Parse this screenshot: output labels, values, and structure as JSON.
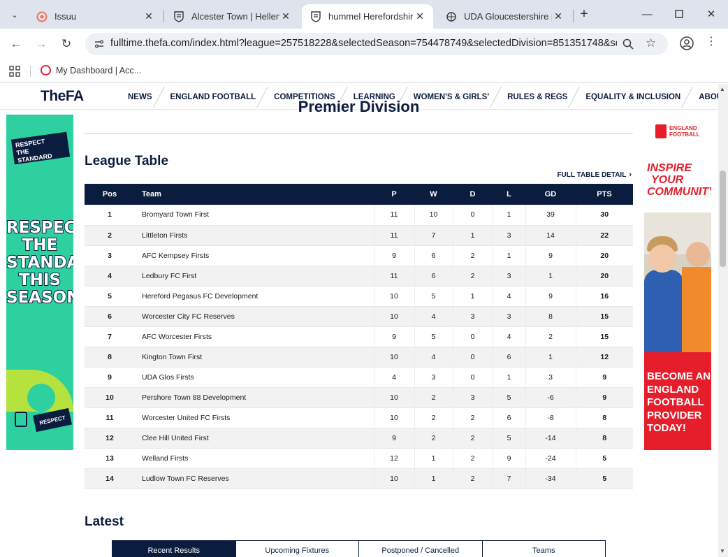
{
  "browser": {
    "tabs": [
      {
        "title": "Issuu",
        "active": false
      },
      {
        "title": "Alcester Town | Hellenic",
        "active": false
      },
      {
        "title": "hummel Herefordshire",
        "active": true
      },
      {
        "title": "UDA Gloucestershire pr",
        "active": false
      }
    ],
    "url": "fulltime.thefa.com/index.html?league=257518228&selectedSeason=754478749&selectedDivision=851351748&sel...",
    "bookmarks": [
      {
        "label": "My Dashboard | Acc..."
      }
    ]
  },
  "site": {
    "logo": "TheFA",
    "nav": [
      "NEWS",
      "ENGLAND FOOTBALL",
      "COMPETITIONS",
      "LEARNING",
      "WOMEN'S & GIRLS'",
      "RULES & REGS",
      "EQUALITY & INCLUSION",
      "ABOUT"
    ]
  },
  "ads": {
    "left": {
      "badge_line1": "RESPECT",
      "badge_line2": "THE STANDARD",
      "big_lines": [
        "RESPECT",
        "THE",
        "STANDARD",
        "THIS",
        "SEASON"
      ],
      "footer_badge": "RESPECT"
    },
    "right": {
      "logo_line1": "ENGLAND",
      "logo_line2": "FOOTBALL",
      "headline_lines": [
        "INSPIRE",
        "YOUR",
        "COMMUNITY"
      ],
      "cta_lines": [
        "BECOME AN",
        "ENGLAND",
        "FOOTBALL",
        "PROVIDER",
        "TODAY!"
      ]
    }
  },
  "main": {
    "division_title": "Premier Division",
    "section_title": "League Table",
    "full_table_detail": "FULL TABLE DETAIL",
    "columns": [
      "Pos",
      "Team",
      "P",
      "W",
      "D",
      "L",
      "GD",
      "PTS"
    ],
    "rows": [
      {
        "pos": "1",
        "team": "Bromyard Town First",
        "p": "11",
        "w": "10",
        "d": "0",
        "l": "1",
        "gd": "39",
        "pts": "30"
      },
      {
        "pos": "2",
        "team": "Littleton Firsts",
        "p": "11",
        "w": "7",
        "d": "1",
        "l": "3",
        "gd": "14",
        "pts": "22"
      },
      {
        "pos": "3",
        "team": "AFC Kempsey Firsts",
        "p": "9",
        "w": "6",
        "d": "2",
        "l": "1",
        "gd": "9",
        "pts": "20"
      },
      {
        "pos": "4",
        "team": "Ledbury FC First",
        "p": "11",
        "w": "6",
        "d": "2",
        "l": "3",
        "gd": "1",
        "pts": "20"
      },
      {
        "pos": "5",
        "team": "Hereford Pegasus FC Development",
        "p": "10",
        "w": "5",
        "d": "1",
        "l": "4",
        "gd": "9",
        "pts": "16"
      },
      {
        "pos": "6",
        "team": "Worcester City FC Reserves",
        "p": "10",
        "w": "4",
        "d": "3",
        "l": "3",
        "gd": "8",
        "pts": "15"
      },
      {
        "pos": "7",
        "team": "AFC Worcester Firsts",
        "p": "9",
        "w": "5",
        "d": "0",
        "l": "4",
        "gd": "2",
        "pts": "15"
      },
      {
        "pos": "8",
        "team": "Kington Town First",
        "p": "10",
        "w": "4",
        "d": "0",
        "l": "6",
        "gd": "1",
        "pts": "12"
      },
      {
        "pos": "9",
        "team": "UDA Glos Firsts",
        "p": "4",
        "w": "3",
        "d": "0",
        "l": "1",
        "gd": "3",
        "pts": "9"
      },
      {
        "pos": "10",
        "team": "Pershore Town 88 Development",
        "p": "10",
        "w": "2",
        "d": "3",
        "l": "5",
        "gd": "-6",
        "pts": "9"
      },
      {
        "pos": "11",
        "team": "Worcester United FC Firsts",
        "p": "10",
        "w": "2",
        "d": "2",
        "l": "6",
        "gd": "-8",
        "pts": "8"
      },
      {
        "pos": "12",
        "team": "Clee Hill United First",
        "p": "9",
        "w": "2",
        "d": "2",
        "l": "5",
        "gd": "-14",
        "pts": "8"
      },
      {
        "pos": "13",
        "team": "Welland Firsts",
        "p": "12",
        "w": "1",
        "d": "2",
        "l": "9",
        "gd": "-24",
        "pts": "5"
      },
      {
        "pos": "14",
        "team": "Ludlow Town FC Reserves",
        "p": "10",
        "w": "1",
        "d": "2",
        "l": "7",
        "gd": "-34",
        "pts": "5"
      }
    ],
    "latest_title": "Latest",
    "latest_tabs": [
      {
        "label": "Recent Results",
        "active": true
      },
      {
        "label": "Upcoming Fixtures",
        "active": false
      },
      {
        "label": "Postponed / Cancelled",
        "active": false
      },
      {
        "label": "Teams",
        "active": false
      }
    ]
  },
  "colors": {
    "fa_navy": "#0b1d3f",
    "respect_green": "#2ed0a0",
    "england_red": "#e61e2b"
  }
}
